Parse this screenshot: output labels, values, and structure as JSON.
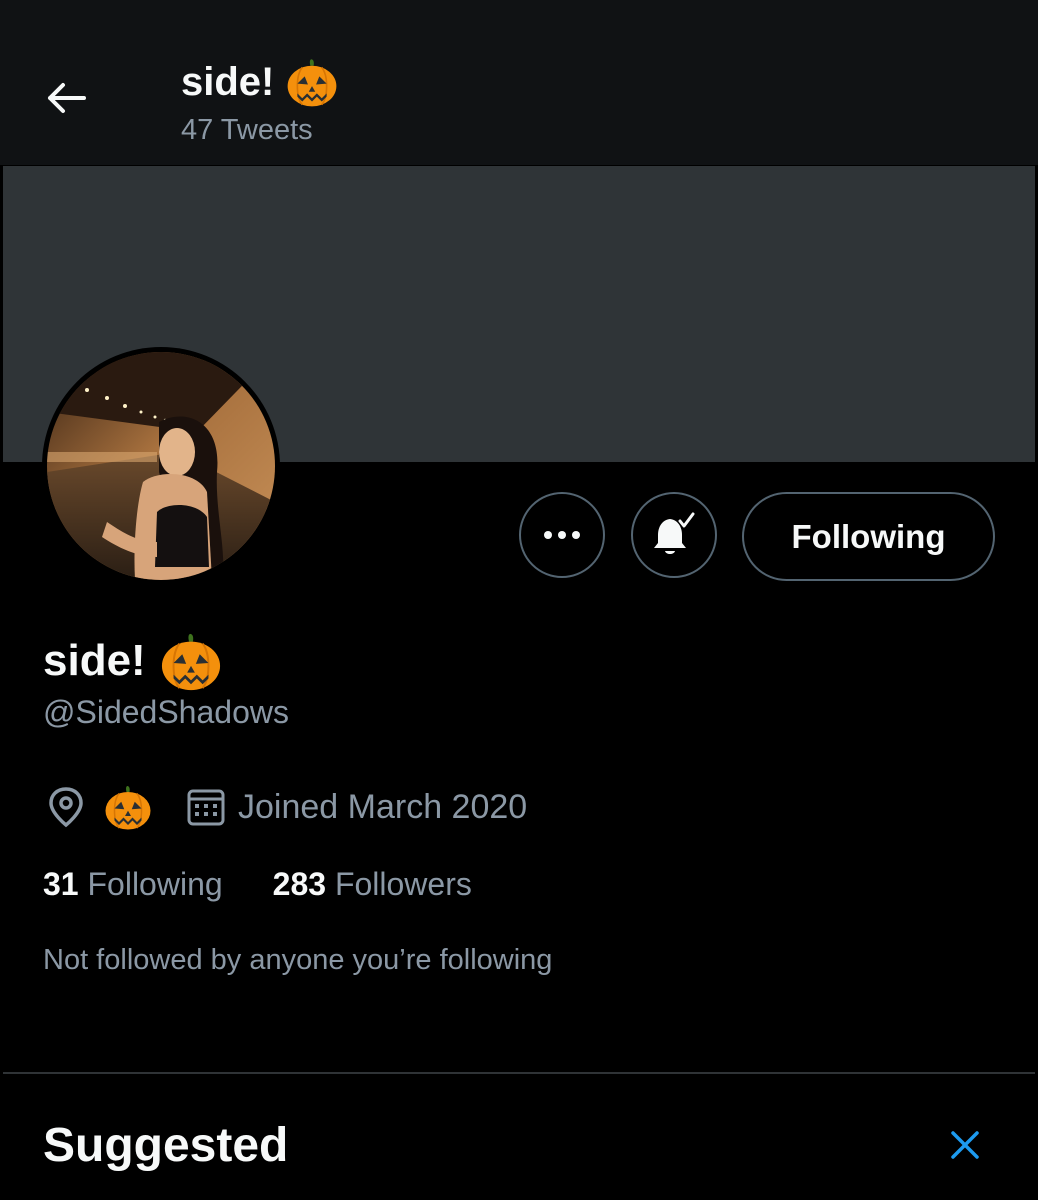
{
  "header": {
    "title": "side!",
    "tweet_count": "47 Tweets",
    "title_emoji": "pumpkin-icon"
  },
  "profile": {
    "display_name": "side!",
    "name_emoji": "pumpkin-icon",
    "handle": "@SidedShadows",
    "location_emoji": "pumpkin-icon",
    "joined": "Joined March 2020",
    "following_count": "31",
    "following_label": "Following",
    "followers_count": "283",
    "followers_label": "Followers",
    "followed_by_note": "Not followed by anyone you’re following"
  },
  "actions": {
    "more_icon": "more-dots-icon",
    "notify_icon": "bell-check-icon",
    "follow_label": "Following"
  },
  "suggested": {
    "heading": "Suggested",
    "close_icon": "close-icon"
  },
  "colors": {
    "background": "#000000",
    "banner": "#2f3437",
    "secondary_text": "#8b98a5",
    "accent": "#1d9bf0",
    "pumpkin": "#f4900c"
  }
}
